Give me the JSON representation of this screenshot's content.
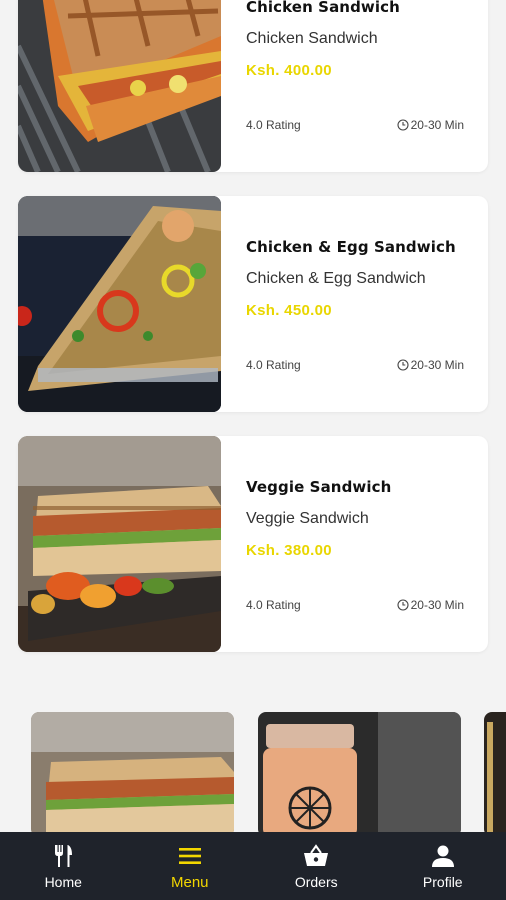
{
  "menu_items": [
    {
      "title": "Chicken Sandwich",
      "subtitle": "Chicken Sandwich",
      "price": "Ksh. 400.00",
      "rating": "4.0 Rating",
      "time": "20-30 Min"
    },
    {
      "title": "Chicken & Egg Sandwich",
      "subtitle": "Chicken & Egg Sandwich",
      "price": "Ksh. 450.00",
      "rating": "4.0 Rating",
      "time": "20-30 Min"
    },
    {
      "title": "Veggie Sandwich",
      "subtitle": "Veggie Sandwich",
      "price": "Ksh. 380.00",
      "rating": "4.0 Rating",
      "time": "20-30 Min"
    }
  ],
  "bottom_nav": {
    "items": [
      {
        "label": "Home",
        "icon": "fork-knife-icon"
      },
      {
        "label": "Menu",
        "icon": "hamburger-menu-icon",
        "active": true
      },
      {
        "label": "Orders",
        "icon": "basket-icon"
      },
      {
        "label": "Profile",
        "icon": "person-icon"
      }
    ],
    "active_color": "#f2d600",
    "background": "#1f232b"
  },
  "colors": {
    "price": "#e9d600",
    "background": "#f3f3f3"
  }
}
